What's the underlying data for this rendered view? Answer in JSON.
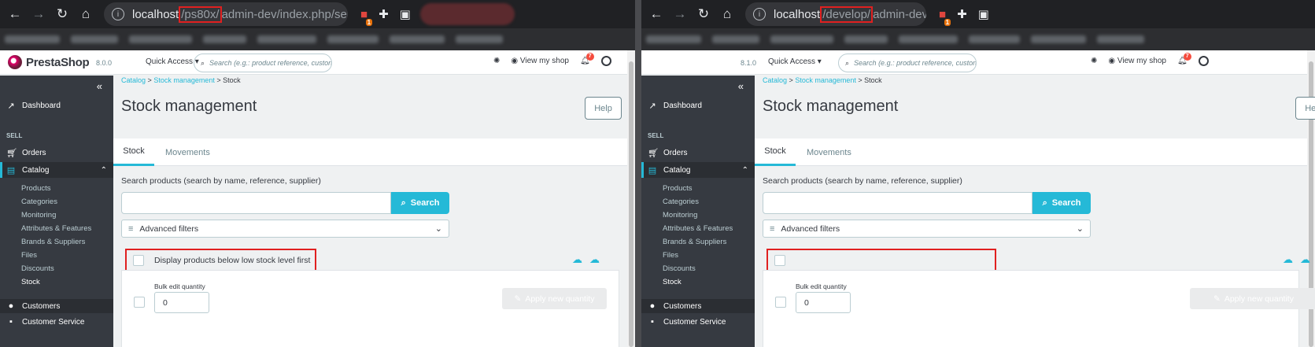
{
  "left": {
    "url_host": "localhost",
    "url_highlight": "/ps80x/",
    "url_rest": "admin-dev/index.php/sell/...",
    "version": "8.0.0"
  },
  "right": {
    "url_host": "localhost",
    "url_highlight": "/develop/",
    "url_rest": "admin-dev/ind...",
    "version": "8.1.0"
  },
  "ext_badge": "1",
  "brand": "PrestaShop",
  "header": {
    "quick_access": "Quick Access",
    "search_placeholder": "Search (e.g.: product reference, custon",
    "view_shop": "View my shop",
    "notif_count": "7"
  },
  "sidebar": {
    "dashboard": "Dashboard",
    "section_sell": "SELL",
    "orders": "Orders",
    "catalog": "Catalog",
    "sub": [
      "Products",
      "Categories",
      "Monitoring",
      "Attributes & Features",
      "Brands & Suppliers",
      "Files",
      "Discounts",
      "Stock"
    ],
    "customers": "Customers",
    "customer_service": "Customer Service"
  },
  "breadcrumb": {
    "catalog": "Catalog",
    "stock_mgmt": "Stock management",
    "stock": "Stock",
    "sep": ">"
  },
  "page_title": "Stock management",
  "help": "Help",
  "tabs": {
    "stock": "Stock",
    "movements": "Movements"
  },
  "search_label": "Search products (search by name, reference, supplier)",
  "search_button": "Search",
  "advanced_filters": "Advanced filters",
  "low_stock_label": "Display products below low stock level first",
  "bulk_label": "Bulk edit quantity",
  "bulk_value": "0",
  "apply_button": "Apply new quantity"
}
